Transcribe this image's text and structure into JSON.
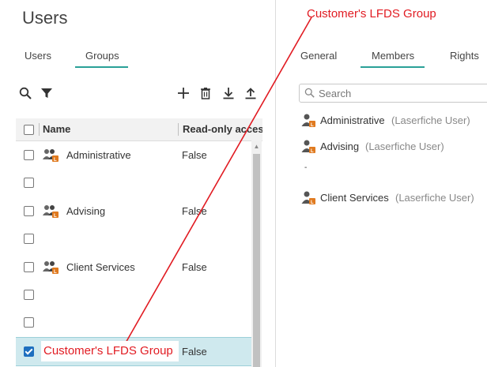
{
  "page": {
    "title": "Users"
  },
  "left_tabs": [
    {
      "label": "Users",
      "active": false
    },
    {
      "label": "Groups",
      "active": true
    }
  ],
  "right_tabs": [
    {
      "label": "General",
      "active": false
    },
    {
      "label": "Members",
      "active": true
    },
    {
      "label": "Rights",
      "active": false
    }
  ],
  "toolbar": {
    "icons": [
      "search-icon",
      "filter-icon",
      "add-icon",
      "delete-icon",
      "download-icon",
      "upload-icon"
    ]
  },
  "table": {
    "columns": [
      "Name",
      "Read-only access"
    ],
    "rows": [
      {
        "name": "Administrative",
        "read_only": "False",
        "checked": false,
        "has_icon": true
      },
      {
        "name": "",
        "read_only": "",
        "checked": false,
        "has_icon": false
      },
      {
        "name": "Advising",
        "read_only": "False",
        "checked": false,
        "has_icon": true
      },
      {
        "name": "",
        "read_only": "",
        "checked": false,
        "has_icon": false
      },
      {
        "name": "Client Services",
        "read_only": "False",
        "checked": false,
        "has_icon": true
      },
      {
        "name": "",
        "read_only": "",
        "checked": false,
        "has_icon": false
      },
      {
        "name": "",
        "read_only": "",
        "checked": false,
        "has_icon": false
      },
      {
        "name": "",
        "read_only": "False",
        "checked": true,
        "has_icon": false
      }
    ]
  },
  "members_panel": {
    "search_placeholder": "Search",
    "members": [
      {
        "name": "Administrative",
        "type": "(Laserfiche User)"
      },
      {
        "name": "Advising",
        "type": "(Laserfiche User)"
      },
      {
        "name": "-",
        "type": ""
      },
      {
        "name": "Client Services",
        "type": "(Laserfiche User)"
      }
    ]
  },
  "annotations": {
    "top_label": "Customer's LFDS Group",
    "bottom_label": "Customer's LFDS Group",
    "color": "#e11b22"
  },
  "colors": {
    "accent": "#2aa198",
    "selected_row": "#cfe9ee",
    "checkbox_checked": "#1e6fbf",
    "badge": "#e07a1f"
  }
}
